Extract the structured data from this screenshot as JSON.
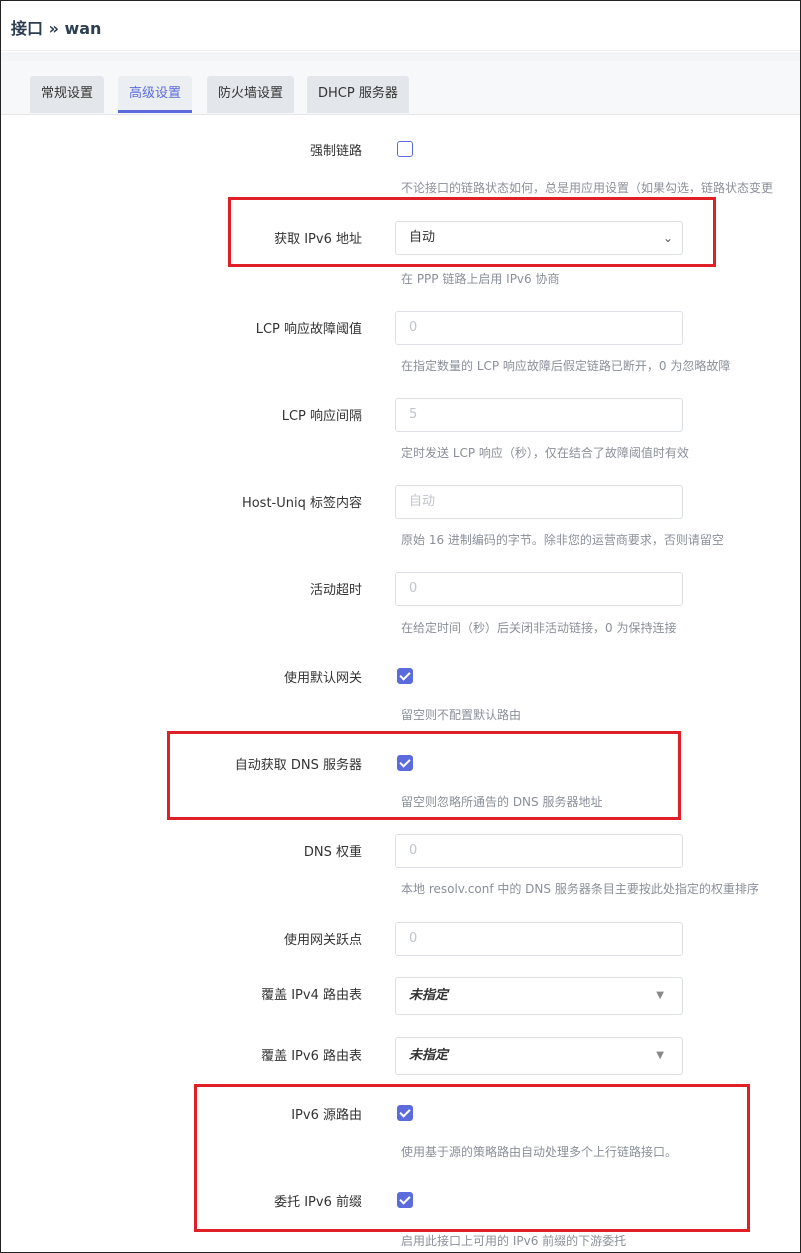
{
  "header": {
    "title": "接口 » wan"
  },
  "tabs": [
    {
      "label": "常规设置"
    },
    {
      "label": "高级设置"
    },
    {
      "label": "防火墙设置"
    },
    {
      "label": "DHCP 服务器"
    }
  ],
  "active_tab": "高级设置",
  "form": {
    "force_link": {
      "label": "强制链路",
      "checked": false,
      "help": "不论接口的链路状态如何，总是用应用设置（如果勾选，链路状态变更"
    },
    "ipv6": {
      "label": "获取 IPv6 地址",
      "value": "自动",
      "help": "在 PPP 链路上启用 IPv6 协商"
    },
    "lcp_fail": {
      "label": "LCP 响应故障阈值",
      "placeholder": "0",
      "help": "在指定数量的 LCP 响应故障后假定链路已断开，0 为忽略故障"
    },
    "lcp_interval": {
      "label": "LCP 响应间隔",
      "placeholder": "5",
      "help": "定时发送 LCP 响应（秒），仅在结合了故障阈值时有效"
    },
    "host_uniq": {
      "label": "Host-Uniq 标签内容",
      "placeholder": "自动",
      "help": "原始 16 进制编码的字节。除非您的运营商要求，否则请留空"
    },
    "idle": {
      "label": "活动超时",
      "placeholder": "0",
      "help": "在给定时间（秒）后关闭非活动链接，0 为保持连接"
    },
    "default_gw": {
      "label": "使用默认网关",
      "checked": true,
      "help": "留空则不配置默认路由"
    },
    "peer_dns": {
      "label": "自动获取 DNS 服务器",
      "checked": true,
      "help": "留空则忽略所通告的 DNS 服务器地址"
    },
    "dns_weight": {
      "label": "DNS 权重",
      "placeholder": "0",
      "help": "本地 resolv.conf 中的 DNS 服务器条目主要按此处指定的权重排序"
    },
    "metric": {
      "label": "使用网关跃点",
      "placeholder": "0"
    },
    "ip4table": {
      "label": "覆盖 IPv4 路由表",
      "value": "未指定"
    },
    "ip6table": {
      "label": "覆盖 IPv6 路由表",
      "value": "未指定"
    },
    "src_route": {
      "label": "IPv6 源路由",
      "checked": true,
      "help": "使用基于源的策略路由自动处理多个上行链路接口。"
    },
    "delegate": {
      "label": "委托 IPv6 前缀",
      "checked": true,
      "help": "启用此接口上可用的 IPv6 前缀的下游委托"
    }
  },
  "colors": {
    "accent": "#5b6bdb",
    "highlight": "#e02027"
  }
}
